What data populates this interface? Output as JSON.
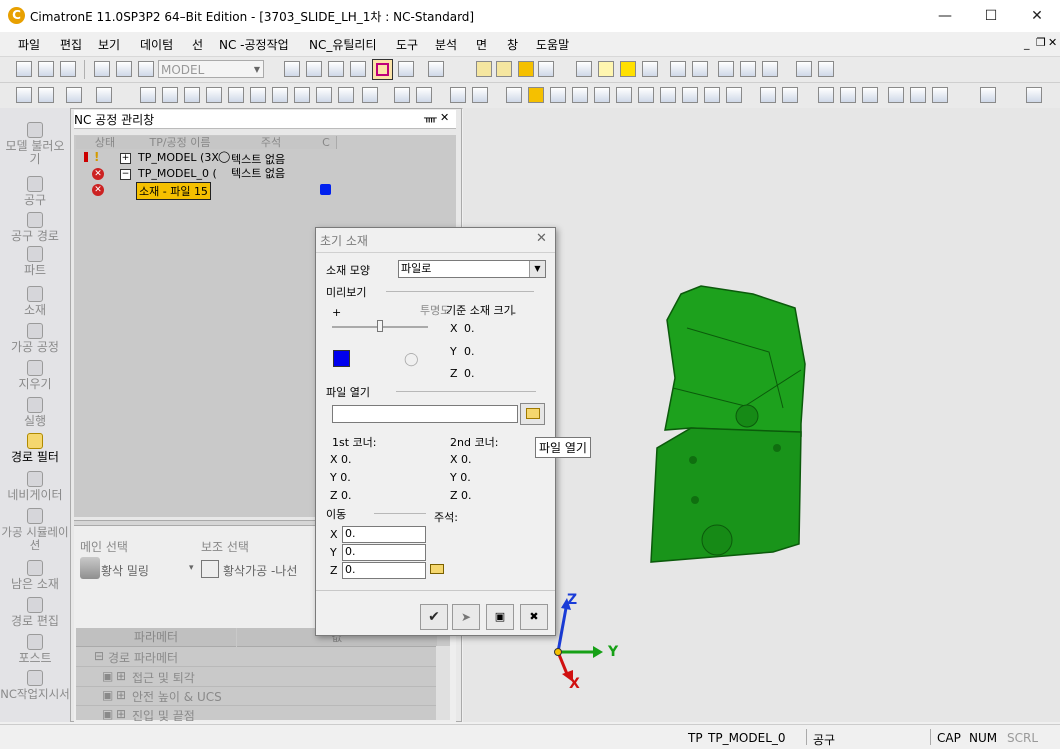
{
  "window": {
    "title": "CimatronE 11.0SP3P2 64–Bit Edition - [3703_SLIDE_LH_1차 : NC-Standard]",
    "logo_letter": "C"
  },
  "menu": [
    "파일",
    "편집",
    "보기",
    "데이텀",
    "선",
    "NC -공정작업",
    "NC_유틸리티",
    "도구",
    "분석",
    "면",
    "창",
    "도움말"
  ],
  "toolbar": {
    "model_combo": "MODEL"
  },
  "sidebar": {
    "items": [
      "모델 불러오기",
      "공구",
      "공구 경로",
      "파트",
      "소재",
      "가공 공정",
      "지우기",
      "실행",
      "경로 필터",
      "네비게이터",
      "가공 시뮬레이션",
      "남은 소재",
      "경로 편집",
      "포스트",
      "NC작업지시서"
    ]
  },
  "nc_manager": {
    "title": "NC 공정 관리창",
    "pin": "ᚄ",
    "close": "✕",
    "columns": [
      "상태",
      "TP/공정 이름",
      "주석",
      "C"
    ],
    "rows": [
      {
        "name": "TP_MODEL (3X",
        "comment": "텍스트 없음"
      },
      {
        "name": "TP_MODEL_0 (",
        "comment": "텍스트 없음"
      },
      {
        "name": "소재 - 파일  15",
        "comment": ""
      }
    ],
    "main_select_label": "메인 선택",
    "sub_select_label": "보조 선택",
    "main_select_value": "황삭 밀링",
    "sub_select_value": "황삭가공 -나선",
    "param_header": "파라메터",
    "param_header2": "값",
    "params": [
      "경로 파라메터",
      "접근 및 퇴각",
      "안전 높이 & UCS",
      "진입 및 끝점"
    ]
  },
  "dialog": {
    "title": "초기 소재",
    "shape_label": "소재 모양",
    "shape_value": "파일로",
    "preview_label": "미리보기",
    "plus": "+",
    "minus": "-",
    "transparency_label": "투명도",
    "base_size_label": "기준 소재 크기",
    "x_label": "X",
    "y_label": "Y",
    "z_label": "Z",
    "base_x": "0.",
    "base_y": "0.",
    "base_z": "0.",
    "file_open_label": "파일 열기",
    "file_path": "",
    "corner1_label": "1st 코너:",
    "corner2_label": "2nd 코너:",
    "c1x": "X 0.",
    "c1y": "Y 0.",
    "c1z": "Z 0.",
    "c2x": "X 0.",
    "c2y": "Y 0.",
    "c2z": "Z 0.",
    "move_label": "이동",
    "note_label": "주석:",
    "move_x": "0.",
    "move_y": "0.",
    "move_z": "0.",
    "tooltip": "파일 열기",
    "preview_color": "#0000ee"
  },
  "axis": {
    "x": "X",
    "y": "Y",
    "z": "Z"
  },
  "statusbar": {
    "tp": "TP",
    "tp_name": "TP_MODEL_0",
    "mode": "공구",
    "cap": "CAP",
    "num": "NUM",
    "scrl": "SCRL"
  },
  "colors": {
    "model_green": "#1aa01a",
    "highlight": "#f5c000"
  }
}
